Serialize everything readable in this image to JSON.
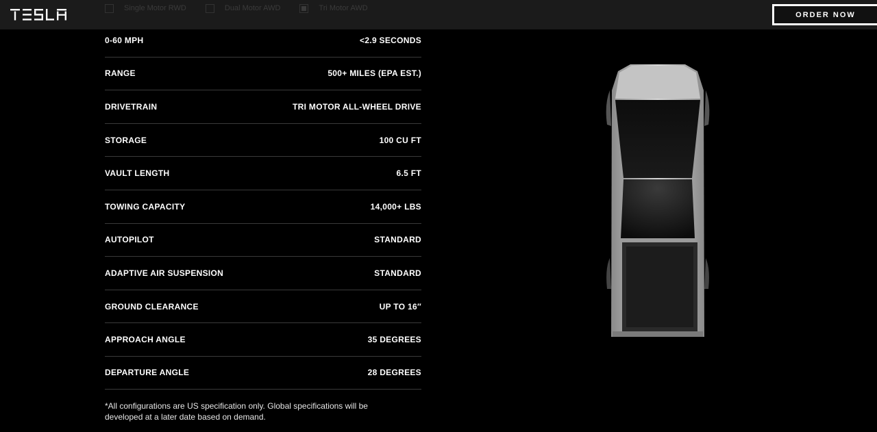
{
  "header": {
    "logo_text": "TESLA",
    "order_label": "ORDER NOW",
    "configs": [
      {
        "label": "Single Motor RWD",
        "checked": false
      },
      {
        "label": "Dual Motor AWD",
        "checked": false
      },
      {
        "label": "Tri Motor AWD",
        "checked": true
      }
    ]
  },
  "specs": [
    {
      "label": "0-60 MPH",
      "value": "<2.9 SECONDS"
    },
    {
      "label": "RANGE",
      "value": "500+ MILES (EPA EST.)"
    },
    {
      "label": "DRIVETRAIN",
      "value": "TRI MOTOR ALL-WHEEL DRIVE"
    },
    {
      "label": "STORAGE",
      "value": "100 CU FT"
    },
    {
      "label": "VAULT LENGTH",
      "value": "6.5 FT"
    },
    {
      "label": "TOWING CAPACITY",
      "value": "14,000+ LBS"
    },
    {
      "label": "AUTOPILOT",
      "value": "STANDARD"
    },
    {
      "label": "ADAPTIVE AIR SUSPENSION",
      "value": "STANDARD"
    },
    {
      "label": "GROUND CLEARANCE",
      "value": "UP TO 16″"
    },
    {
      "label": "APPROACH ANGLE",
      "value": "35 DEGREES"
    },
    {
      "label": "DEPARTURE ANGLE",
      "value": "28 DEGREES"
    }
  ],
  "footnote": "*All configurations are US specification only. Global specifications will be developed at a later date based on demand.",
  "colors": {
    "background": "#000000",
    "header": "#1b1b1b",
    "divider": "#3a3a3a",
    "text": "#ffffff"
  }
}
